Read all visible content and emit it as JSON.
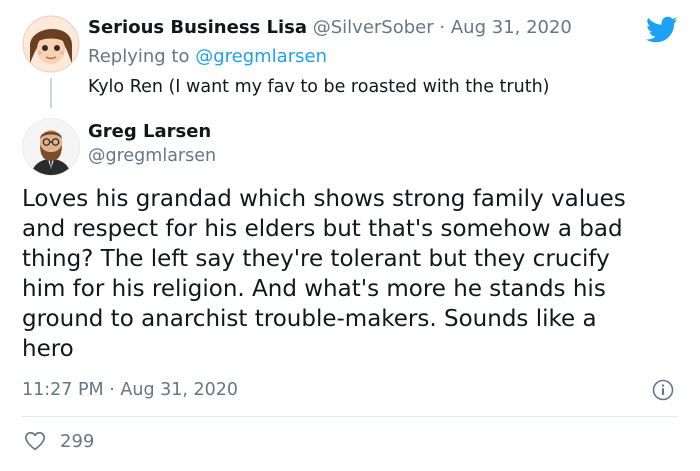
{
  "parent": {
    "name": "Serious Business Lisa",
    "handle": "@SilverSober",
    "separator": "·",
    "date": "Aug 31, 2020",
    "replying_prefix": "Replying to",
    "replying_to": "@gregmlarsen",
    "text": "Kylo Ren (I want my fav to be roasted with the truth)"
  },
  "tweet": {
    "name": "Greg Larsen",
    "handle": "@gregmlarsen",
    "body_lines": [
      "Loves his grandad which shows strong family values",
      "and respect for his elders but that's somehow a bad",
      "thing? The left say they're tolerant but they crucify",
      "him for his religion. And what's more he stands his",
      "ground to anarchist trouble-makers. Sounds like a",
      "hero"
    ],
    "time": "11:27 PM",
    "separator": "·",
    "date": "Aug 31, 2020",
    "likes": "299"
  },
  "icons": {
    "brand": "twitter-bird-icon",
    "info": "info-icon",
    "like": "heart-icon"
  },
  "colors": {
    "brand": "#1da1f2",
    "text": "#14171a",
    "muted": "#657786",
    "divider": "#e1e8ed"
  }
}
